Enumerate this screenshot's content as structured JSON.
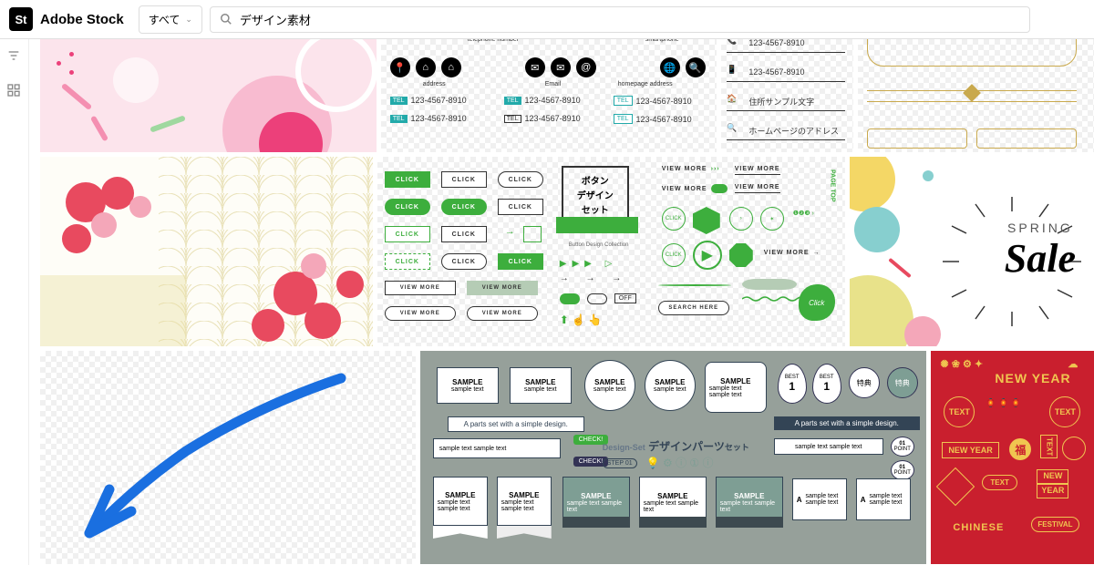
{
  "header": {
    "logo_short": "St",
    "logo_text": "Adobe Stock",
    "dropdown_label": "すべて",
    "search_value": "デザイン素材"
  },
  "tile2": {
    "top_labels": [
      "telephone number",
      "smartphone"
    ],
    "icon_labels": [
      "address",
      "Email",
      "homepage address"
    ],
    "tel": "123-4567-8910",
    "tel_tag": "TEL"
  },
  "tile3": {
    "tel1": "123-4567-8910",
    "tel2": "123-4567-8910",
    "addr": "住所サンプル文字",
    "web": "ホームページのアドレス"
  },
  "tile6": {
    "click": "CLICK",
    "viewmore": "VIEW MORE",
    "box_l1": "ボタン",
    "box_l2": "デザイン",
    "box_l3": "セット",
    "box_sub": "Button Design Collection",
    "search": "SEARCH HERE",
    "pagetop": "PAGE TOP",
    "click_circ": "Click"
  },
  "tile7": {
    "spring": "SPRING",
    "sale": "Sale"
  },
  "tile9": {
    "sample": "SAMPLE",
    "sub": "sample text",
    "sub2": "sample text sample text",
    "banner": "A parts set with a simple design.",
    "check": "CHECK!",
    "title_en": "Design-Set",
    "title_jp": "デザインパーツ",
    "title_suf": "セット",
    "step": "STEP",
    "point": "POINT",
    "best": "BEST",
    "tokuten": "特典",
    "one": "1",
    "a": "A",
    "new": "NEW"
  },
  "tile10": {
    "newyear": "NEW YEAR",
    "text": "TEXT",
    "chinese": "CHINESE",
    "festival": "FESTIVAL",
    "fuku": "福"
  }
}
